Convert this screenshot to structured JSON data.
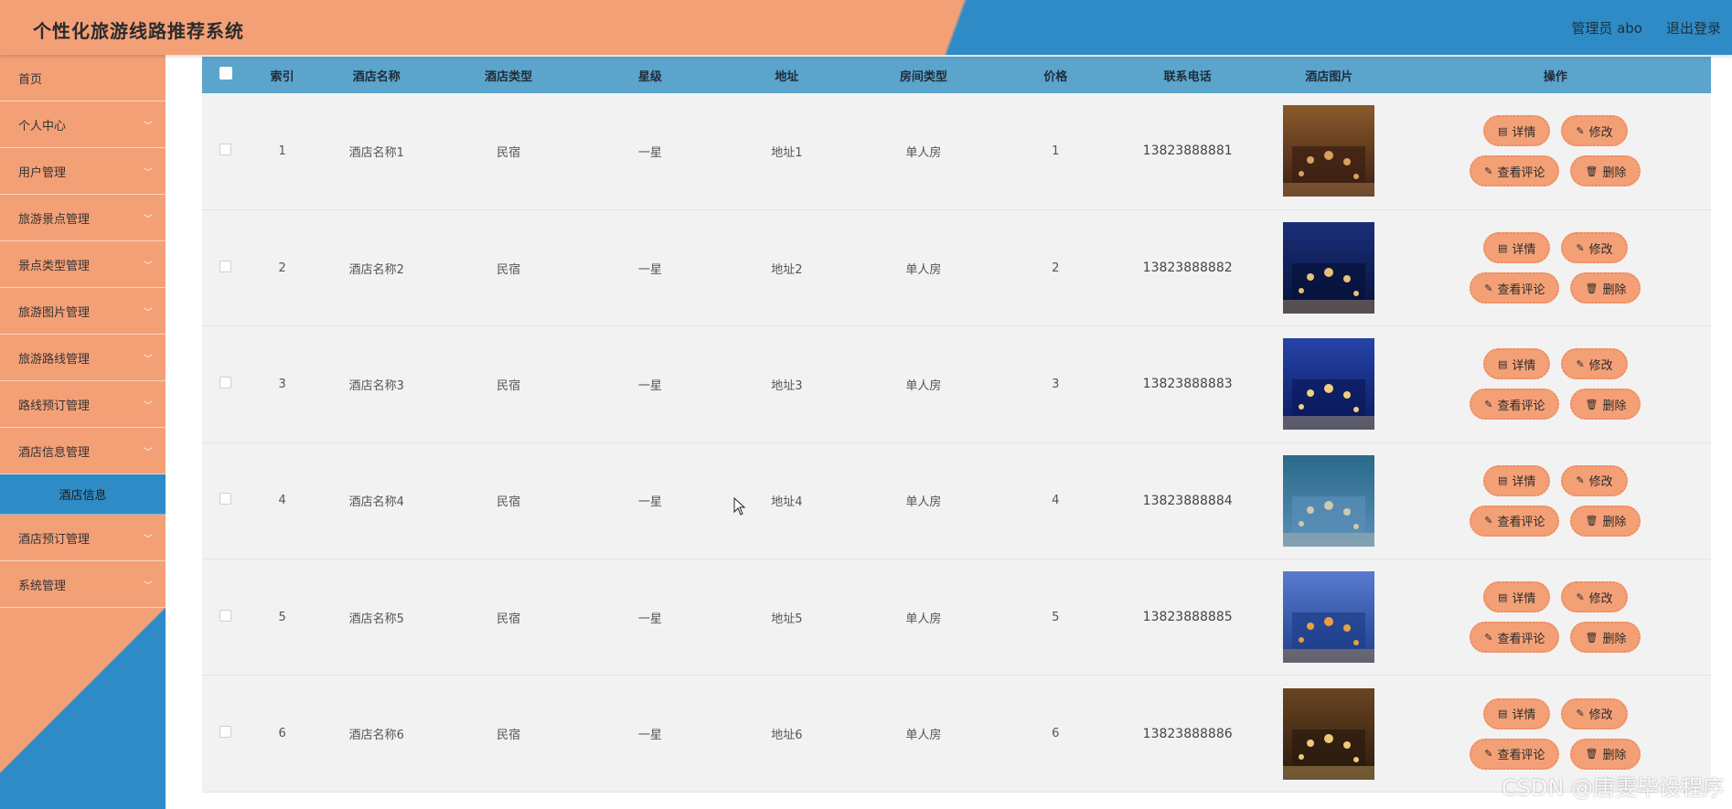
{
  "header": {
    "app_title": "个性化旅游线路推荐系统",
    "admin_label": "管理员 abo",
    "logout_label": "退出登录"
  },
  "sidebar": {
    "items": [
      {
        "label": "首页",
        "has_chevron": false
      },
      {
        "label": "个人中心",
        "has_chevron": true
      },
      {
        "label": "用户管理",
        "has_chevron": true
      },
      {
        "label": "旅游景点管理",
        "has_chevron": true
      },
      {
        "label": "景点类型管理",
        "has_chevron": true
      },
      {
        "label": "旅游图片管理",
        "has_chevron": true
      },
      {
        "label": "旅游路线管理",
        "has_chevron": true
      },
      {
        "label": "路线预订管理",
        "has_chevron": true
      },
      {
        "label": "酒店信息管理",
        "has_chevron": true
      }
    ],
    "active_sub": "酒店信息",
    "items_after": [
      {
        "label": "酒店预订管理",
        "has_chevron": true
      },
      {
        "label": "系统管理",
        "has_chevron": true
      }
    ]
  },
  "table": {
    "columns": [
      "索引",
      "酒店名称",
      "酒店类型",
      "星级",
      "地址",
      "房间类型",
      "价格",
      "联系电话",
      "酒店图片",
      "操作"
    ],
    "rows": [
      {
        "index": "1",
        "name": "酒店名称1",
        "type": "民宿",
        "star": "一星",
        "address": "地址1",
        "room": "单人房",
        "price": "1",
        "phone": "13823888881",
        "image": "hotel-lobby-night"
      },
      {
        "index": "2",
        "name": "酒店名称2",
        "type": "民宿",
        "star": "一星",
        "address": "地址2",
        "room": "单人房",
        "price": "2",
        "phone": "13823888882",
        "image": "hotel-tower-night"
      },
      {
        "index": "3",
        "name": "酒店名称3",
        "type": "民宿",
        "star": "一星",
        "address": "地址3",
        "room": "单人房",
        "price": "3",
        "phone": "13823888883",
        "image": "city-skyline-night"
      },
      {
        "index": "4",
        "name": "酒店名称4",
        "type": "民宿",
        "star": "一星",
        "address": "地址4",
        "room": "单人房",
        "price": "4",
        "phone": "13823888884",
        "image": "resort-aerial"
      },
      {
        "index": "5",
        "name": "酒店名称5",
        "type": "民宿",
        "star": "一星",
        "address": "地址5",
        "room": "单人房",
        "price": "5",
        "phone": "13823888885",
        "image": "hotel-facade-dusk"
      },
      {
        "index": "6",
        "name": "酒店名称6",
        "type": "民宿",
        "star": "一星",
        "address": "地址6",
        "room": "单人房",
        "price": "6",
        "phone": "13823888886",
        "image": "banquet-hall"
      }
    ],
    "actions": {
      "detail": "详情",
      "edit": "修改",
      "comments": "查看评论",
      "delete": "删除"
    }
  },
  "watermark": "CSDN @唐雯毕设程序",
  "colors": {
    "orange": "#f4a077",
    "blue": "#2e8bc6",
    "header_row": "#5ba4cc"
  }
}
